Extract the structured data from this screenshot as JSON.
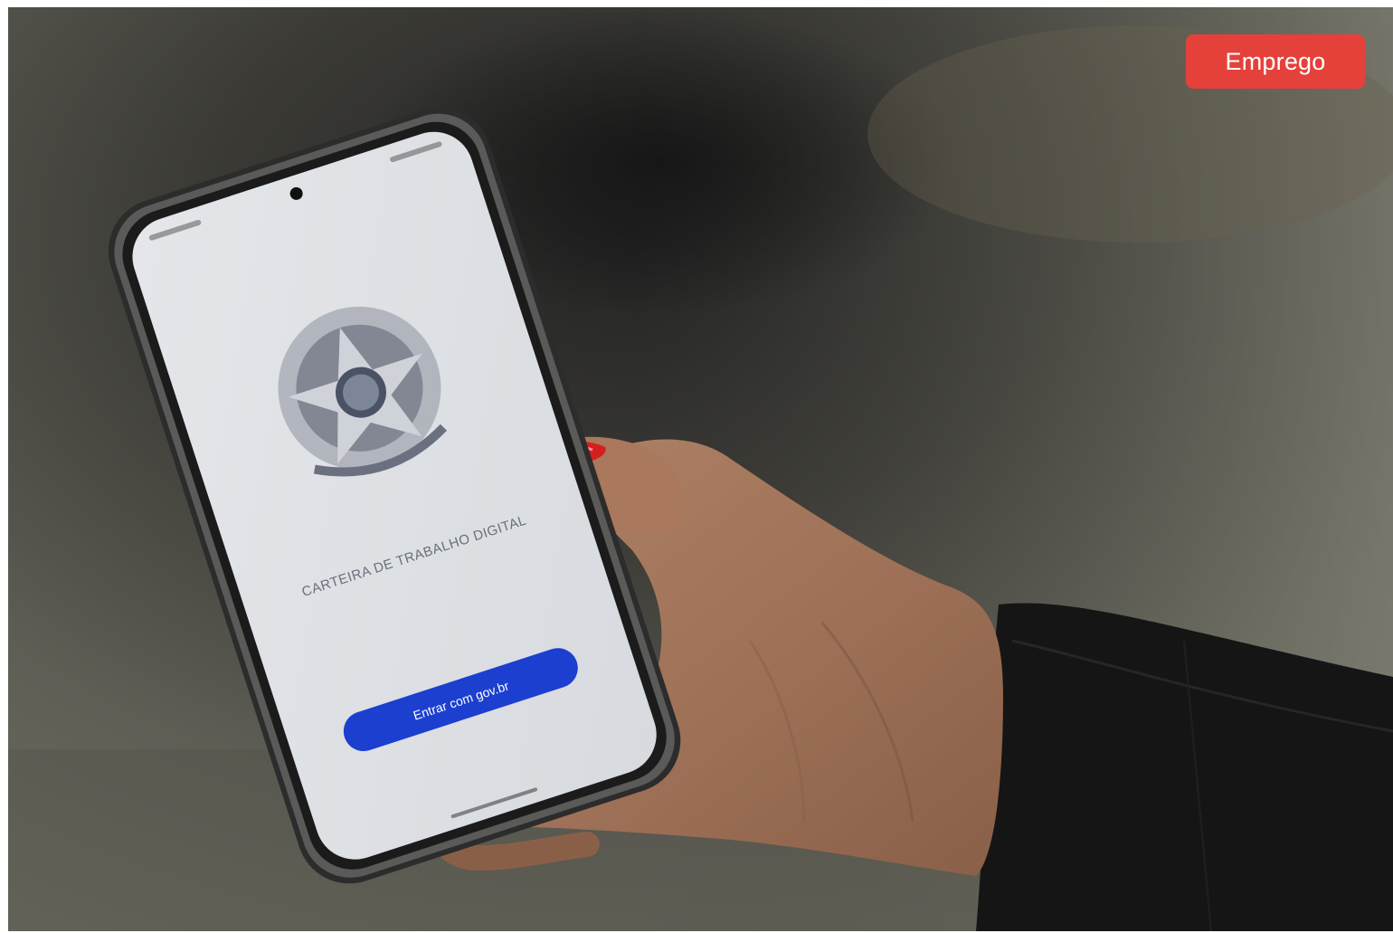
{
  "badge": {
    "label": "Emprego",
    "color": "#e5413b"
  },
  "photo": {
    "screen_title": "CARTEIRA DE TRABALHO DIGITAL",
    "screen_button_label": "Entrar com gov.br",
    "emblem_icon": "brasao-republica-icon"
  }
}
